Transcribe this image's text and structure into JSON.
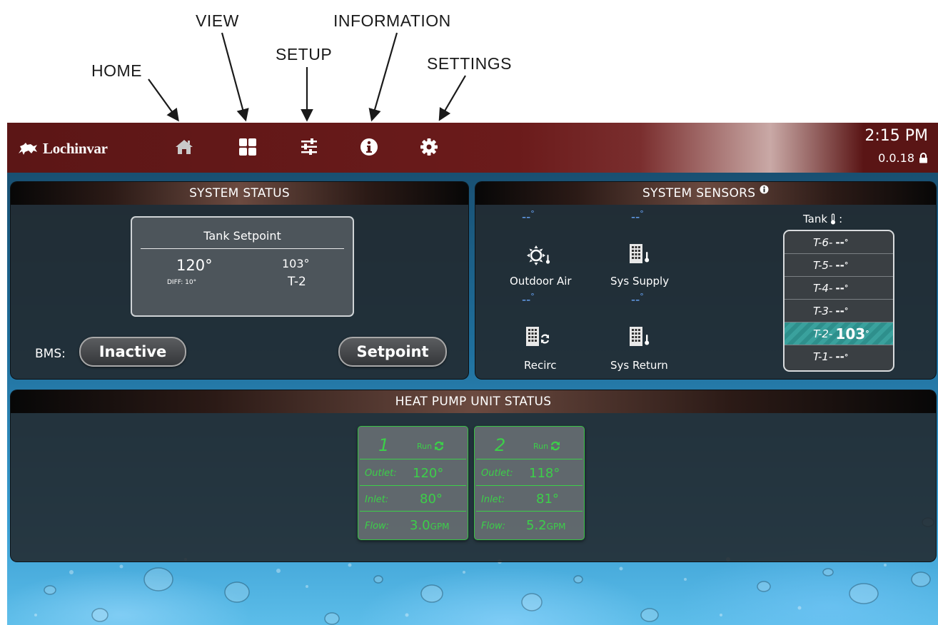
{
  "annotations": {
    "home": "HOME",
    "view": "VIEW",
    "setup": "SETUP",
    "information": "INFORMATION",
    "settings": "SETTINGS"
  },
  "header": {
    "logo_text": "Lochinvar",
    "time": "2:15 PM",
    "version": "0.0.18",
    "nav_icons": [
      "home-icon",
      "view-grid-icon",
      "setup-sliders-icon",
      "info-icon",
      "settings-gear-icon"
    ]
  },
  "system_status": {
    "title": "SYSTEM STATUS",
    "setpoint_title": "Tank Setpoint",
    "setpoint_value": "120°",
    "diff": "DIFF: 10°",
    "current_temp": "103°",
    "current_sensor": "T-2",
    "bms_label": "BMS:",
    "bms_button": "Inactive",
    "setpoint_button": "Setpoint"
  },
  "system_sensors": {
    "title": "SYSTEM SENSORS",
    "outdoor_air": {
      "label": "Outdoor Air",
      "value": "--"
    },
    "sys_supply": {
      "label": "Sys Supply",
      "value": "--"
    },
    "recirc": {
      "label": "Recirc",
      "value": "--"
    },
    "sys_return": {
      "label": "Sys Return",
      "value": "--"
    },
    "tank_label": "Tank",
    "tank_rows": [
      {
        "label": "T-6",
        "sep": " - ",
        "value": "--"
      },
      {
        "label": "T-5",
        "sep": " - ",
        "value": "--"
      },
      {
        "label": "T-4",
        "sep": " - ",
        "value": "--"
      },
      {
        "label": "T-3",
        "sep": " - ",
        "value": "--"
      },
      {
        "label": "T-2",
        "sep": " - ",
        "value": "103"
      },
      {
        "label": "T-1",
        "sep": " - ",
        "value": "--"
      }
    ]
  },
  "heat_pump": {
    "title": "HEAT PUMP UNIT STATUS",
    "units": [
      {
        "number": "1",
        "status": "Run",
        "outlet_label": "Outlet:",
        "outlet": "120°",
        "inlet_label": "Inlet:",
        "inlet": "80°",
        "flow_label": "Flow:",
        "flow": "3.0",
        "flow_unit": "GPM"
      },
      {
        "number": "2",
        "status": "Run",
        "outlet_label": "Outlet:",
        "outlet": "118°",
        "inlet_label": "Inlet:",
        "inlet": "81°",
        "flow_label": "Flow:",
        "flow": "5.2",
        "flow_unit": "GPM"
      }
    ]
  },
  "colors": {
    "header_maroon": "#5c1616",
    "run_green": "#3ccf49",
    "active_tank_teal": "#2e8f8c",
    "sensor_dash_blue": "#6aa9ff"
  }
}
